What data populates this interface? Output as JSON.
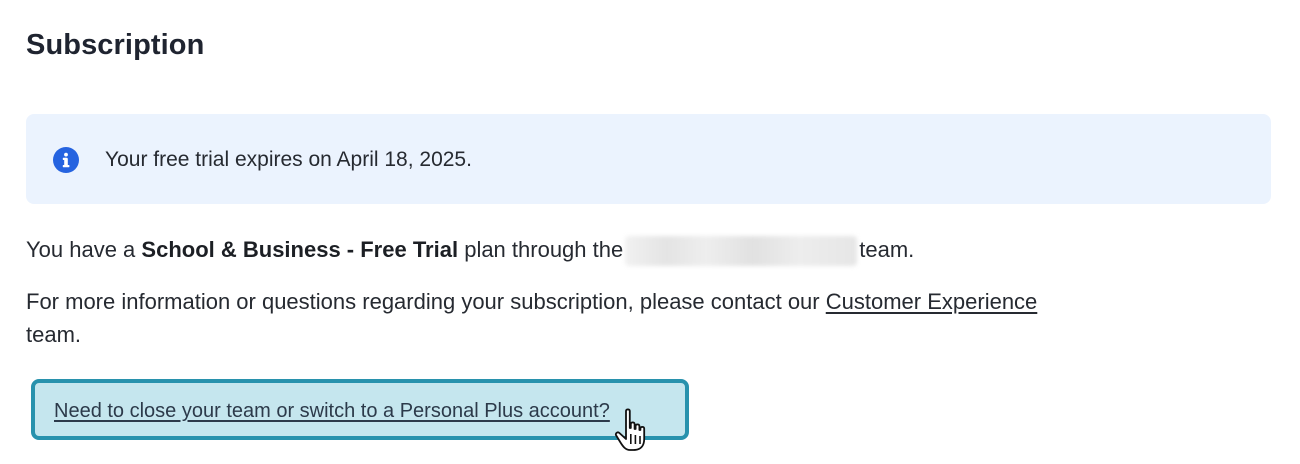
{
  "page": {
    "title": "Subscription"
  },
  "banner": {
    "icon": "info-icon",
    "text": "Your free trial expires on April 18, 2025.",
    "background": "#ebf3fe",
    "icon_color": "#2563e0"
  },
  "plan": {
    "prefix": "You have a",
    "plan_name": "School & Business - Free Trial",
    "middle": "plan through the",
    "suffix": "team."
  },
  "contact": {
    "before_link": "For more information or questions regarding your subscription, please contact our",
    "link_label": "Customer Experience",
    "after_link": "team."
  },
  "team_action": {
    "link_label": "Need to close your team or switch to a Personal Plus account?",
    "highlight_border": "#2892ad",
    "highlight_fill": "#c5e6ee"
  },
  "cursor": {
    "icon": "hand-pointer-icon"
  }
}
